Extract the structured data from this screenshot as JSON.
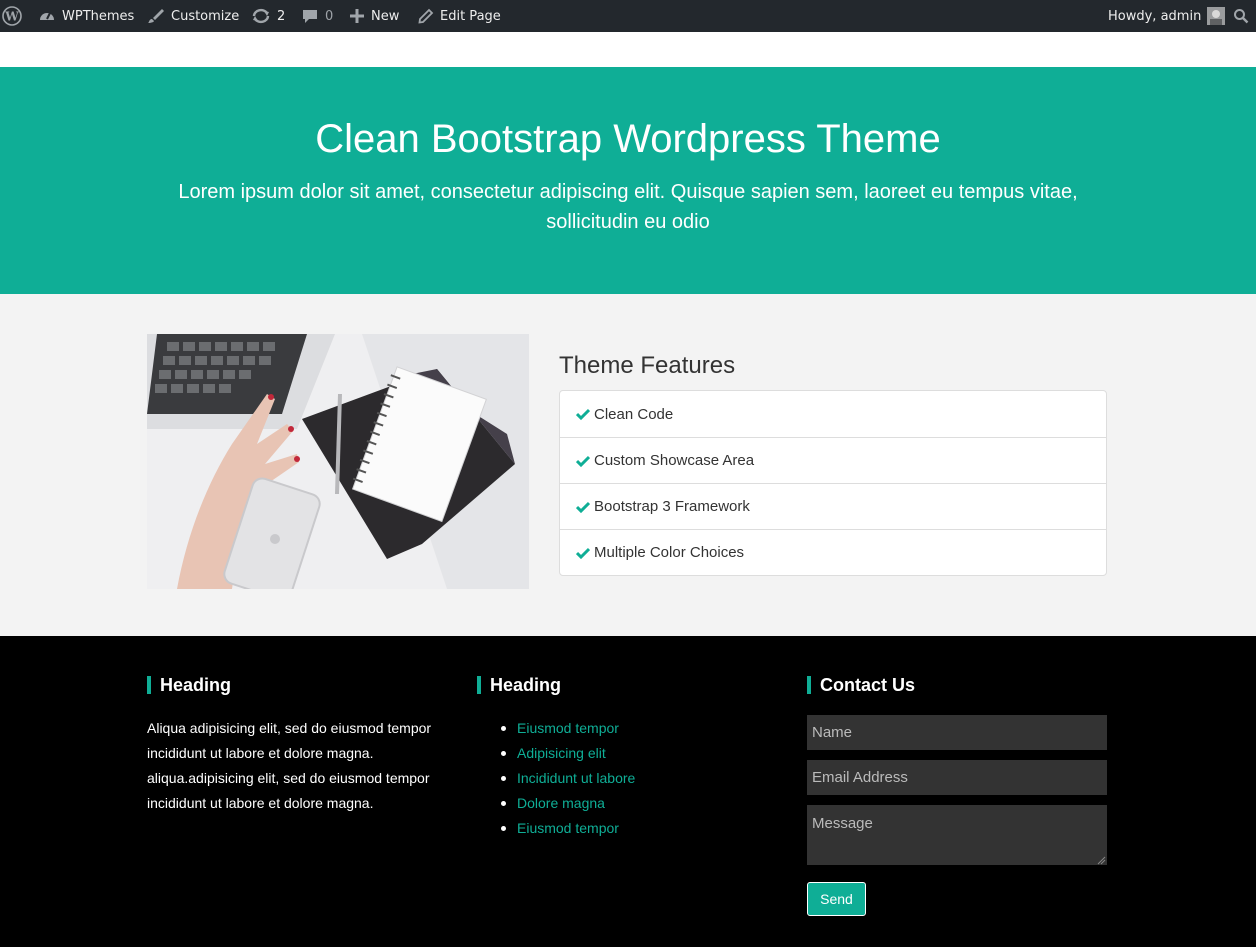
{
  "adminbar": {
    "site_name": "WPThemes",
    "customize": "Customize",
    "updates_count": "2",
    "comments_count": "0",
    "new_label": "New",
    "edit_page": "Edit Page",
    "howdy": "Howdy, admin"
  },
  "hero": {
    "title": "Clean Bootstrap Wordpress Theme",
    "subtitle": "Lorem ipsum dolor sit amet, consectetur adipiscing elit. Quisque sapien sem, laoreet eu tempus vitae, sollicitudin eu odio"
  },
  "features": {
    "title": "Theme Features",
    "items": [
      "Clean Code",
      "Custom Showcase Area",
      "Bootstrap 3 Framework",
      "Multiple Color Choices"
    ]
  },
  "footer": {
    "col1": {
      "heading": "Heading",
      "text": "Aliqua adipisicing elit, sed do eiusmod tempor incididunt ut labore et dolore magna. aliqua.adipisicing elit, sed do eiusmod tempor incididunt ut labore et dolore magna."
    },
    "col2": {
      "heading": "Heading",
      "links": [
        "Eiusmod tempor",
        "Adipisicing elit",
        "Incididunt ut labore",
        "Dolore magna",
        "Eiusmod tempor"
      ]
    },
    "contact": {
      "heading": "Contact Us",
      "name_placeholder": "Name",
      "email_placeholder": "Email Address",
      "message_placeholder": "Message",
      "send_label": "Send"
    }
  },
  "colors": {
    "accent": "#0fae96",
    "adminbar_bg": "#23282d",
    "footer_bg": "#000000",
    "features_bg": "#f3f3f3"
  }
}
